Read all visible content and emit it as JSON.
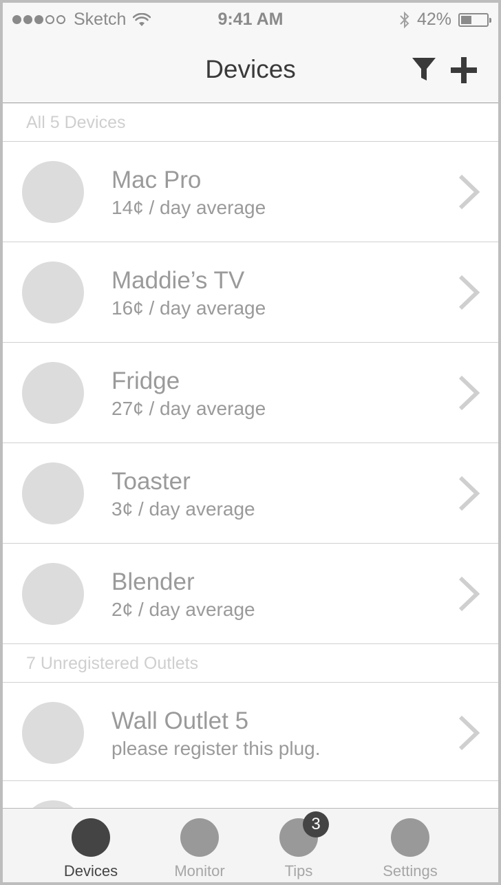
{
  "status_bar": {
    "carrier": "Sketch",
    "time": "9:41 AM",
    "battery_text": "42%",
    "battery_level": 0.42,
    "signal_bars_filled": 3,
    "signal_bars_total": 5,
    "icons": [
      "wifi-icon",
      "bluetooth-icon",
      "battery-icon"
    ]
  },
  "nav": {
    "title": "Devices",
    "filter_icon": "filter-icon",
    "add_icon": "plus-icon"
  },
  "sections": [
    {
      "header": "All 5 Devices",
      "rows": [
        {
          "title": "Mac Pro",
          "subtitle": "14¢ / day average"
        },
        {
          "title": "Maddie’s TV",
          "subtitle": "16¢ / day average"
        },
        {
          "title": "Fridge",
          "subtitle": "27¢ / day average"
        },
        {
          "title": "Toaster",
          "subtitle": "3¢ / day average"
        },
        {
          "title": "Blender",
          "subtitle": "2¢ / day average"
        }
      ]
    },
    {
      "header": "7 Unregistered Outlets",
      "rows": [
        {
          "title": "Wall Outlet 5",
          "subtitle": "please register this plug."
        }
      ]
    }
  ],
  "tab_bar": {
    "tabs": [
      {
        "label": "Devices",
        "active": true
      },
      {
        "label": "Monitor",
        "active": false
      },
      {
        "label": "Tips",
        "active": false,
        "badge": "3"
      },
      {
        "label": "Settings",
        "active": false
      }
    ]
  },
  "colors": {
    "active_tab": "#444444",
    "inactive_tab": "#999999",
    "avatar_placeholder": "#dcdcdc",
    "text_gray": "#9a9a9a"
  }
}
